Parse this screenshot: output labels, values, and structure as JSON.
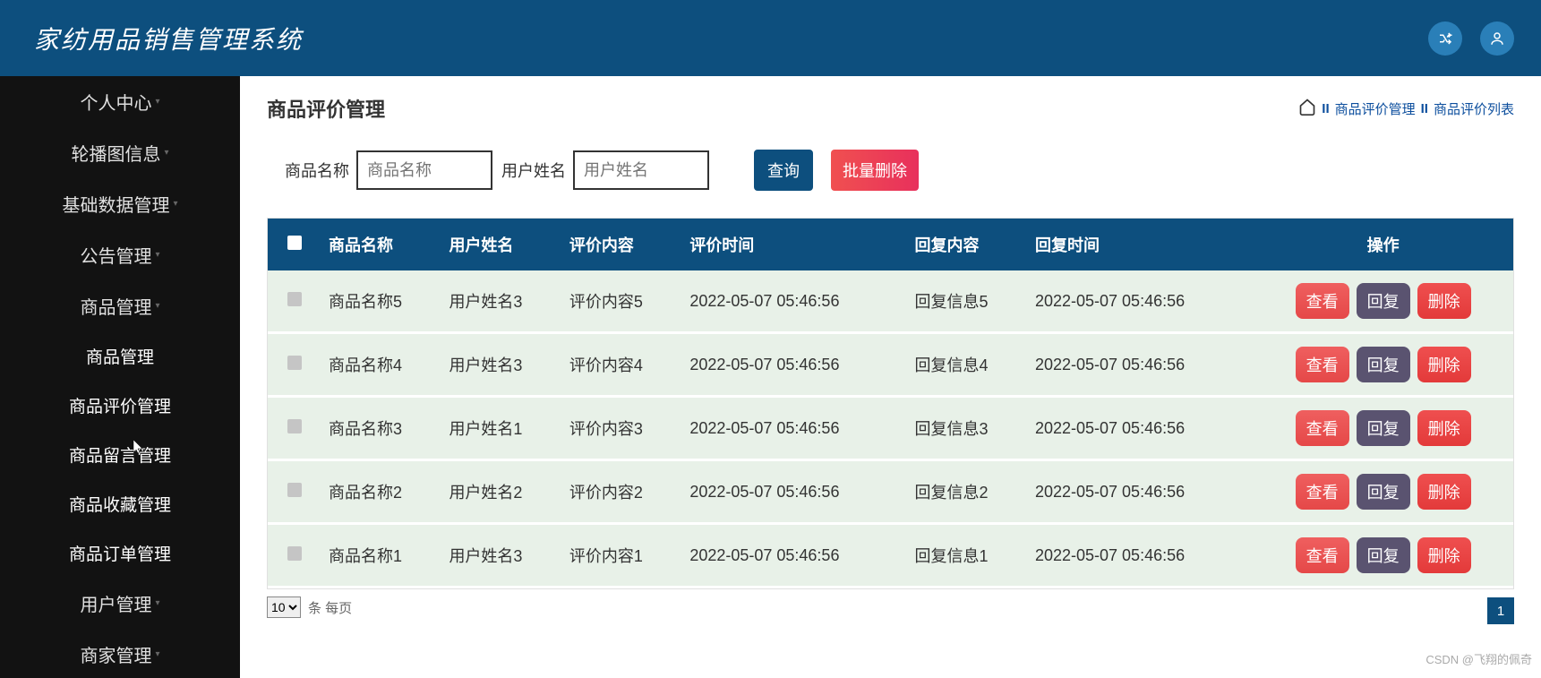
{
  "header": {
    "title": "家纺用品销售管理系统"
  },
  "sidebar": {
    "items": [
      {
        "label": "个人中心",
        "caret": true
      },
      {
        "label": "轮播图信息",
        "caret": true
      },
      {
        "label": "基础数据管理",
        "caret": true
      },
      {
        "label": "公告管理",
        "caret": true
      },
      {
        "label": "商品管理",
        "caret": true
      },
      {
        "label": "商品管理",
        "caret": false,
        "indent": true,
        "active": true
      },
      {
        "label": "商品评价管理",
        "caret": false,
        "indent": true,
        "active": true
      },
      {
        "label": "商品留言管理",
        "caret": false,
        "indent": true,
        "active": true
      },
      {
        "label": "商品收藏管理",
        "caret": false,
        "indent": true,
        "active": true
      },
      {
        "label": "商品订单管理",
        "caret": false,
        "indent": true,
        "active": true
      },
      {
        "label": "用户管理",
        "caret": true
      },
      {
        "label": "商家管理",
        "caret": true
      }
    ]
  },
  "page": {
    "title": "商品评价管理"
  },
  "breadcrumb": {
    "a": "商品评价管理",
    "b": "商品评价列表"
  },
  "search": {
    "label1": "商品名称",
    "ph1": "商品名称",
    "label2": "用户姓名",
    "ph2": "用户姓名",
    "query": "查询",
    "batch": "批量删除"
  },
  "table": {
    "headers": [
      "商品名称",
      "用户姓名",
      "评价内容",
      "评价时间",
      "回复内容",
      "回复时间",
      "操作"
    ],
    "actions": {
      "view": "查看",
      "reply": "回复",
      "del": "删除"
    },
    "rows": [
      {
        "c0": "商品名称5",
        "c1": "用户姓名3",
        "c2": "评价内容5",
        "c3": "2022-05-07 05:46:56",
        "c4": "回复信息5",
        "c5": "2022-05-07 05:46:56"
      },
      {
        "c0": "商品名称4",
        "c1": "用户姓名3",
        "c2": "评价内容4",
        "c3": "2022-05-07 05:46:56",
        "c4": "回复信息4",
        "c5": "2022-05-07 05:46:56"
      },
      {
        "c0": "商品名称3",
        "c1": "用户姓名1",
        "c2": "评价内容3",
        "c3": "2022-05-07 05:46:56",
        "c4": "回复信息3",
        "c5": "2022-05-07 05:46:56"
      },
      {
        "c0": "商品名称2",
        "c1": "用户姓名2",
        "c2": "评价内容2",
        "c3": "2022-05-07 05:46:56",
        "c4": "回复信息2",
        "c5": "2022-05-07 05:46:56"
      },
      {
        "c0": "商品名称1",
        "c1": "用户姓名3",
        "c2": "评价内容1",
        "c3": "2022-05-07 05:46:56",
        "c4": "回复信息1",
        "c5": "2022-05-07 05:46:56"
      }
    ]
  },
  "pager": {
    "size": "10",
    "label": "条 每页",
    "current": "1"
  },
  "watermark": "CSDN @飞翔的佩奇"
}
